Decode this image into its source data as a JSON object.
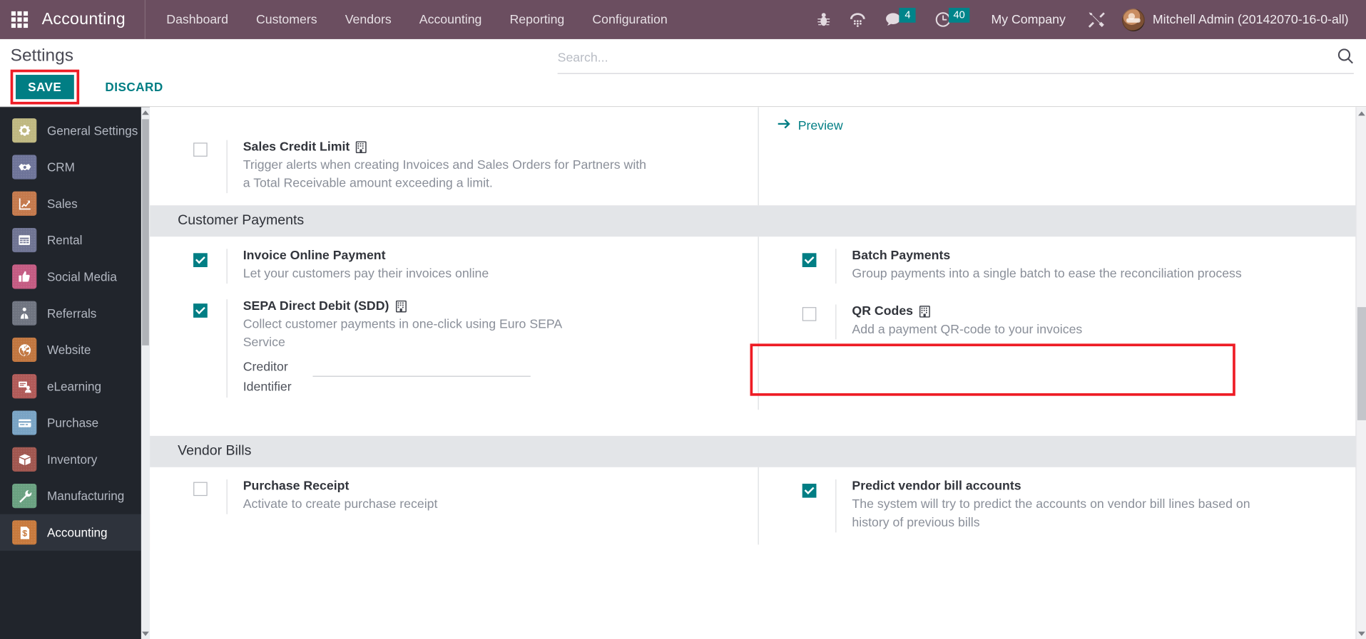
{
  "navbar": {
    "apps_icon": "apps-grid-icon",
    "brand": "Accounting",
    "menus": [
      {
        "label": "Dashboard"
      },
      {
        "label": "Customers"
      },
      {
        "label": "Vendors"
      },
      {
        "label": "Accounting"
      },
      {
        "label": "Reporting"
      },
      {
        "label": "Configuration"
      }
    ],
    "icons": [
      {
        "name": "bug-icon",
        "badge": ""
      },
      {
        "name": "dialpad-icon",
        "badge": ""
      },
      {
        "name": "messages-icon",
        "badge": "4"
      },
      {
        "name": "activity-clock-icon",
        "badge": "40"
      }
    ],
    "company": "My Company",
    "tools_icon": "tools-wrench-icon",
    "user": "Mitchell Admin (20142070-16-0-all)"
  },
  "control_panel": {
    "title": "Settings",
    "save_label": "SAVE",
    "discard_label": "DISCARD",
    "search_placeholder": "Search...",
    "search_value": "",
    "search_icon": "search-icon"
  },
  "sidebar": {
    "items": [
      {
        "label": "General Settings",
        "icon": "gear-icon",
        "color": "#bfb881",
        "active": false
      },
      {
        "label": "CRM",
        "icon": "handshake-icon",
        "color": "#6e7499",
        "active": false
      },
      {
        "label": "Sales",
        "icon": "chart-up-icon",
        "color": "#c4794c",
        "active": false
      },
      {
        "label": "Rental",
        "icon": "calendar-icon",
        "color": "#6f7493",
        "active": false
      },
      {
        "label": "Social Media",
        "icon": "thumbs-up-icon",
        "color": "#c45b82",
        "active": false
      },
      {
        "label": "Referrals",
        "icon": "gift-person-icon",
        "color": "#6f7480",
        "active": false
      },
      {
        "label": "Website",
        "icon": "globe-icon",
        "color": "#c1763f",
        "active": false
      },
      {
        "label": "eLearning",
        "icon": "presentation-icon",
        "color": "#b05a58",
        "active": false
      },
      {
        "label": "Purchase",
        "icon": "credit-card-icon",
        "color": "#79a3c4",
        "active": false
      },
      {
        "label": "Inventory",
        "icon": "box-icon",
        "color": "#a0564f",
        "active": false
      },
      {
        "label": "Manufacturing",
        "icon": "wrench-icon",
        "color": "#6aa181",
        "active": false
      },
      {
        "label": "Accounting",
        "icon": "invoice-dollar-icon",
        "color": "#c87a3d",
        "active": true
      }
    ]
  },
  "content": {
    "preview_link": "Preview",
    "preview_icon": "arrow-right-icon",
    "blocks": [
      {
        "id": "credit-limit",
        "title": "",
        "left": [
          {
            "name": "sales-credit-limit",
            "label": "Sales Credit Limit",
            "help": "Trigger alerts when creating Invoices and Sales Orders for Partners with a Total Receivable amount exceeding a limit.",
            "checked": false,
            "company_dependent": true
          }
        ],
        "right": []
      },
      {
        "id": "customer-payments",
        "title": "Customer Payments",
        "left": [
          {
            "name": "invoice-online-payment",
            "label": "Invoice Online Payment",
            "help": "Let your customers pay their invoices online",
            "checked": true,
            "company_dependent": false
          },
          {
            "name": "sepa-direct-debit",
            "label": "SEPA Direct Debit (SDD)",
            "help": "Collect customer payments in one-click using Euro SEPA Service",
            "checked": true,
            "company_dependent": true,
            "field": {
              "label": "Creditor Identifier",
              "value": "",
              "placeholder": ""
            }
          }
        ],
        "right": [
          {
            "name": "batch-payments",
            "label": "Batch Payments",
            "help": "Group payments into a single batch to ease the reconciliation process",
            "checked": true,
            "company_dependent": false,
            "highlighted": true
          },
          {
            "name": "qr-codes",
            "label": "QR Codes",
            "help": "Add a payment QR-code to your invoices",
            "checked": false,
            "company_dependent": true
          }
        ]
      },
      {
        "id": "vendor-bills",
        "title": "Vendor Bills",
        "left": [
          {
            "name": "purchase-receipt",
            "label": "Purchase Receipt",
            "help": "Activate to create purchase receipt",
            "checked": false,
            "company_dependent": false
          }
        ],
        "right": [
          {
            "name": "predict-vendor-bill-accounts",
            "label": "Predict vendor bill accounts",
            "help": "The system will try to predict the accounts on vendor bill lines based on history of previous bills",
            "checked": true,
            "company_dependent": false
          }
        ]
      }
    ]
  },
  "colors": {
    "brand_purple": "#6b4e60",
    "accent_teal": "#017e84",
    "highlight_red": "#ee1c25",
    "sidebar_dark": "#21252c",
    "section_gray": "#e3e5e8"
  }
}
